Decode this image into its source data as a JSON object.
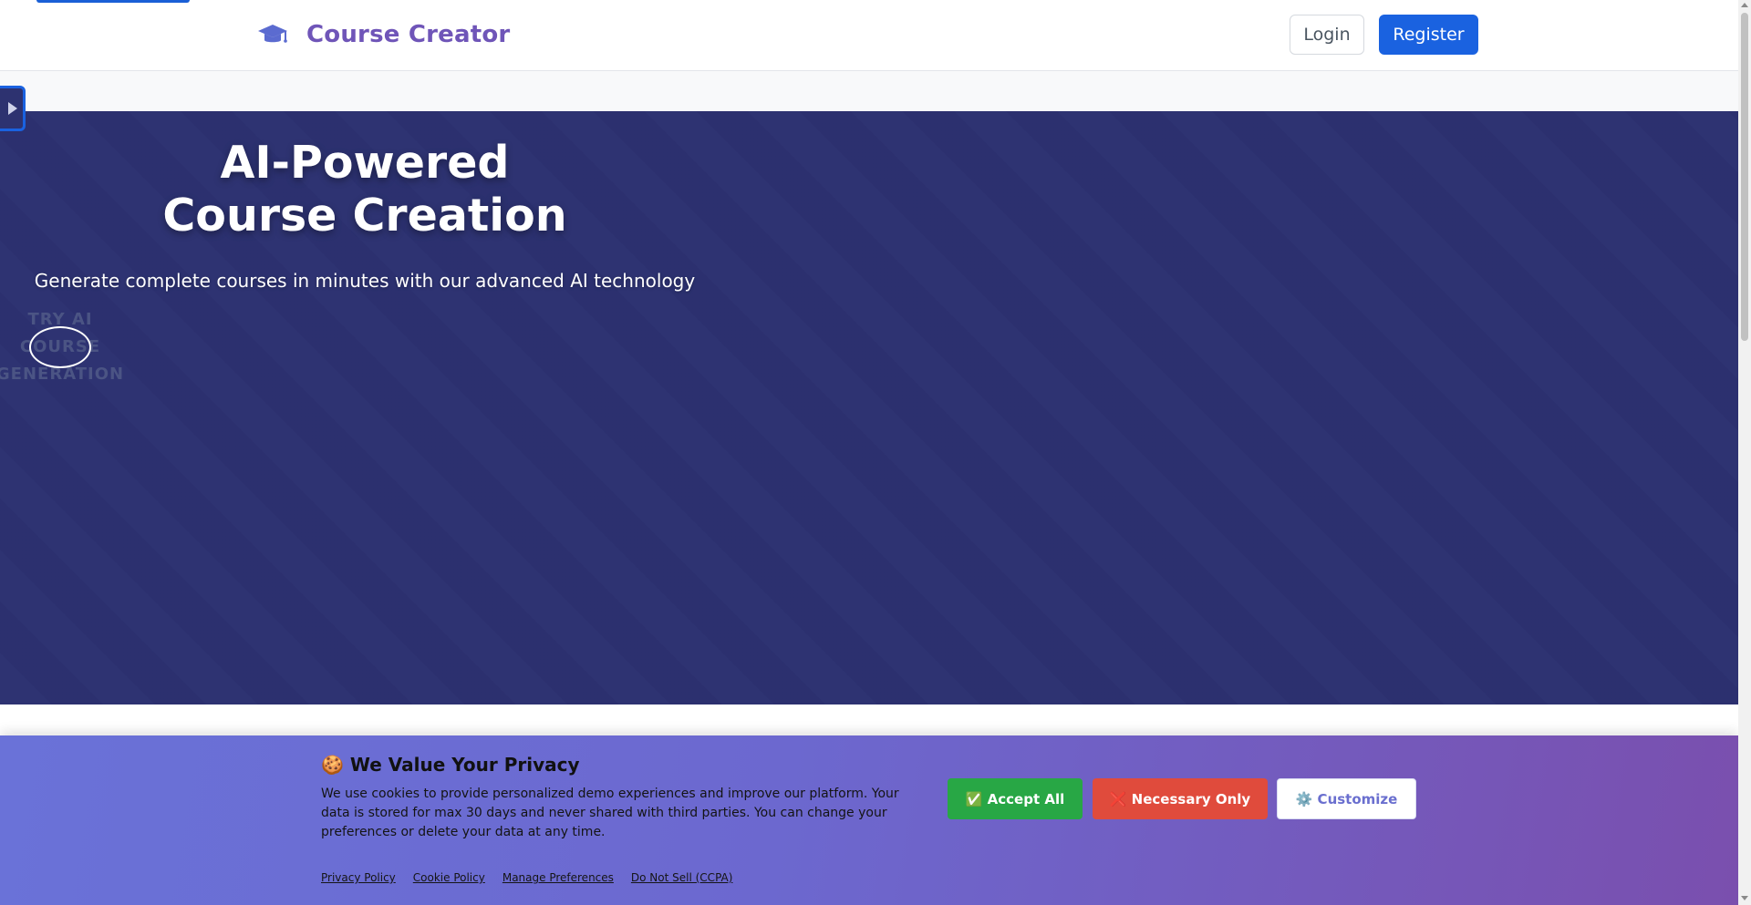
{
  "brand": {
    "name": "Course Creator",
    "icon": "graduation-cap-icon",
    "color": "#6f55b8"
  },
  "nav": {
    "login_label": "Login",
    "register_label": "Register"
  },
  "hero": {
    "title_line1": "AI-Powered",
    "title_line2": "Course Creation",
    "subtitle": "Generate complete courses in minutes with our advanced AI technology",
    "cta_line1": "TRY AI",
    "cta_line2": "COURSE",
    "cta_line3": "GENERATION",
    "background": "#2c3170"
  },
  "cookie_banner": {
    "title": "🍪 We Value Your Privacy",
    "text": "We use cookies to provide personalized demo experiences and improve our platform. Your data is stored for max 30 days and never shared with third parties. You can change your preferences or delete your data at any time.",
    "accept_label": "✅ Accept All",
    "necessary_label": "❌ Necessary Only",
    "customize_label": "⚙️ Customize",
    "links": {
      "privacy": "Privacy Policy",
      "cookie": "Cookie Policy",
      "manage": "Manage Preferences",
      "donotsell": "Do Not Sell (CCPA)"
    }
  },
  "colors": {
    "primary": "#1a62e0",
    "accept": "#28a745",
    "necessary": "#e04b3c"
  }
}
